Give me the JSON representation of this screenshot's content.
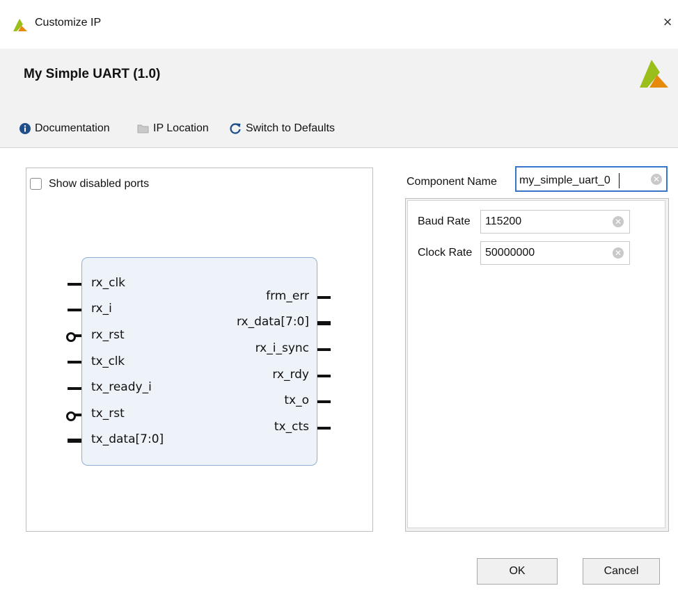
{
  "window": {
    "title": "Customize IP",
    "close_glyph": "×"
  },
  "ip": {
    "title": "My Simple UART (1.0)"
  },
  "toolbar": {
    "documentation": "Documentation",
    "ip_location": "IP Location",
    "switch_defaults": "Switch to Defaults"
  },
  "symbol": {
    "show_disabled_label": "Show disabled ports",
    "show_disabled_checked": false,
    "left_ports": [
      "rx_clk",
      "rx_i",
      "rx_rst",
      "tx_clk",
      "tx_ready_i",
      "tx_rst",
      "tx_data[7:0]"
    ],
    "right_ports": [
      "frm_err",
      "rx_data[7:0]",
      "rx_i_sync",
      "rx_rdy",
      "tx_o",
      "tx_cts"
    ]
  },
  "component": {
    "label": "Component Name",
    "value": "my_simple_uart_0"
  },
  "params": {
    "baud": {
      "label": "Baud Rate",
      "value": "115200"
    },
    "clock": {
      "label": "Clock Rate",
      "value": "50000000"
    }
  },
  "buttons": {
    "ok": "OK",
    "cancel": "Cancel"
  },
  "icons": {
    "app_logo": "xilinx-logo-icon",
    "info": "info-icon",
    "folder": "folder-icon",
    "refresh": "refresh-icon",
    "clear": "clear-icon",
    "close": "close-icon"
  },
  "colors": {
    "logo_yellow": "#9bbf1a",
    "logo_orange": "#e58a0a",
    "focus_blue": "#3874c8",
    "block_fill": "#eef3f9",
    "block_border": "#8eafd3"
  }
}
